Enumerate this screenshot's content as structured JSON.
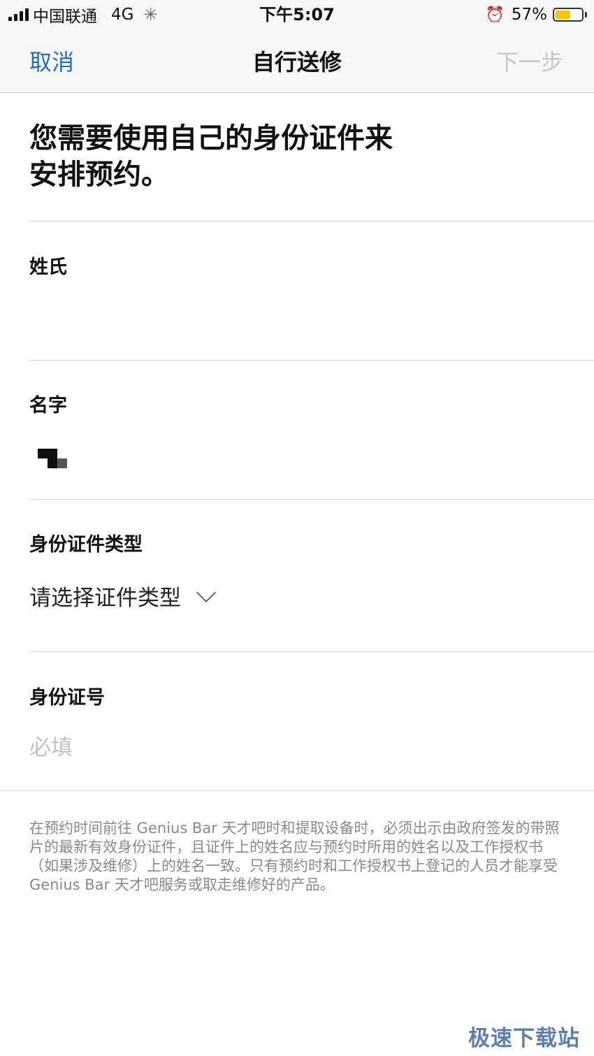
{
  "status_bar": {
    "carrier": "中国联通",
    "network": "4G",
    "time": "下午5:07",
    "battery_percent": "57%",
    "battery_level": 0.57,
    "battery_color": "#f6c400"
  },
  "nav": {
    "cancel_label": "取消",
    "title": "自行送修",
    "next_label": "下一步",
    "cancel_color": "#1f6fc5"
  },
  "heading": {
    "line1": "您需要使用自己的身份证件来",
    "line2": "安排预约。"
  },
  "form": {
    "surname_label": "姓氏",
    "given_name_label": "名字",
    "id_type_label": "身份证件类型",
    "id_type_value": "请选择证件类型",
    "id_number_label": "身份证号",
    "id_number_placeholder": "必填"
  },
  "note": "在预约时间前往 Genius Bar 天才吧时和提取设备时，必须出示由政府签发的带照片的最新有效身份证件，且证件上的姓名应与预约时所用的姓名以及工作授权书（如果涉及维修）上的姓名一致。只有预约时和工作授权书上登记的人员才能享受 Genius Bar 天才吧服务或取走维修好的产品。",
  "watermark": "极速下载站"
}
